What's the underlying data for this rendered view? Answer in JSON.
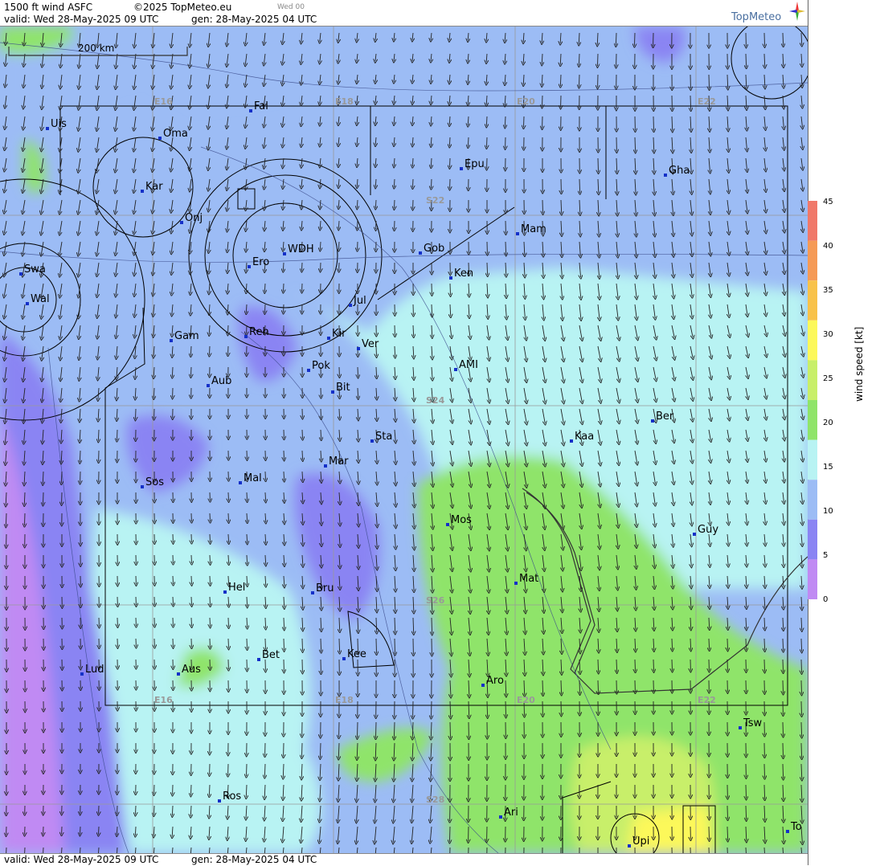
{
  "header": {
    "title": "1500 ft wind ASFC",
    "copyright": "©2025 TopMeteo.eu",
    "run_label": "Wed 00",
    "valid": "valid:  Wed  28-May-2025  09 UTC",
    "gen": "gen: 28-May-2025 04 UTC",
    "logo": "TopMeteo"
  },
  "footer": {
    "valid": "valid:  Wed  28-May-2025  09 UTC",
    "gen": "gen: 28-May-2025 04 UTC"
  },
  "scale": {
    "label": "200 km"
  },
  "colorbar": {
    "title": "wind speed [kt]",
    "ticks": [
      "45",
      "40",
      "35",
      "30",
      "25",
      "20",
      "15",
      "10",
      "5",
      "0"
    ],
    "colors": [
      "#f0786a",
      "#f59a56",
      "#f8c24a",
      "#fcf85a",
      "#c8ef6a",
      "#8fe46a",
      "#b8f3f3",
      "#9cbcf5",
      "#8a84f3",
      "#c08af3"
    ]
  },
  "grid": {
    "lon_labels_top": [
      "E16",
      "E18",
      "E20",
      "E22"
    ],
    "lon_labels_bottom": [
      "E16",
      "E18",
      "E20",
      "E22"
    ],
    "lat_labels": [
      "S22",
      "S24",
      "S26",
      "S28"
    ]
  },
  "places": [
    {
      "name": "Uis"
    },
    {
      "name": "Fal"
    },
    {
      "name": "Oma"
    },
    {
      "name": "Kar"
    },
    {
      "name": "Epu"
    },
    {
      "name": "Gha"
    },
    {
      "name": "Onj"
    },
    {
      "name": "Mam"
    },
    {
      "name": "Gob"
    },
    {
      "name": "Swa"
    },
    {
      "name": "WDH"
    },
    {
      "name": "Ero"
    },
    {
      "name": "Ken"
    },
    {
      "name": "Wal"
    },
    {
      "name": "Jul"
    },
    {
      "name": "Gam"
    },
    {
      "name": "Reh"
    },
    {
      "name": "Kir"
    },
    {
      "name": "Ver"
    },
    {
      "name": "AMI"
    },
    {
      "name": "Pok"
    },
    {
      "name": "Aub"
    },
    {
      "name": "Bit"
    },
    {
      "name": "Ber"
    },
    {
      "name": "Sta"
    },
    {
      "name": "Kaa"
    },
    {
      "name": "Mar"
    },
    {
      "name": "Sos"
    },
    {
      "name": "Mal"
    },
    {
      "name": "Mos"
    },
    {
      "name": "Guy"
    },
    {
      "name": "Mat"
    },
    {
      "name": "Hel"
    },
    {
      "name": "Bru"
    },
    {
      "name": "Bet"
    },
    {
      "name": "Kee"
    },
    {
      "name": "Lud"
    },
    {
      "name": "Aus"
    },
    {
      "name": "Aro"
    },
    {
      "name": "Tsw"
    },
    {
      "name": "Ros"
    },
    {
      "name": "Ari"
    },
    {
      "name": "To"
    },
    {
      "name": "Upi"
    }
  ]
}
